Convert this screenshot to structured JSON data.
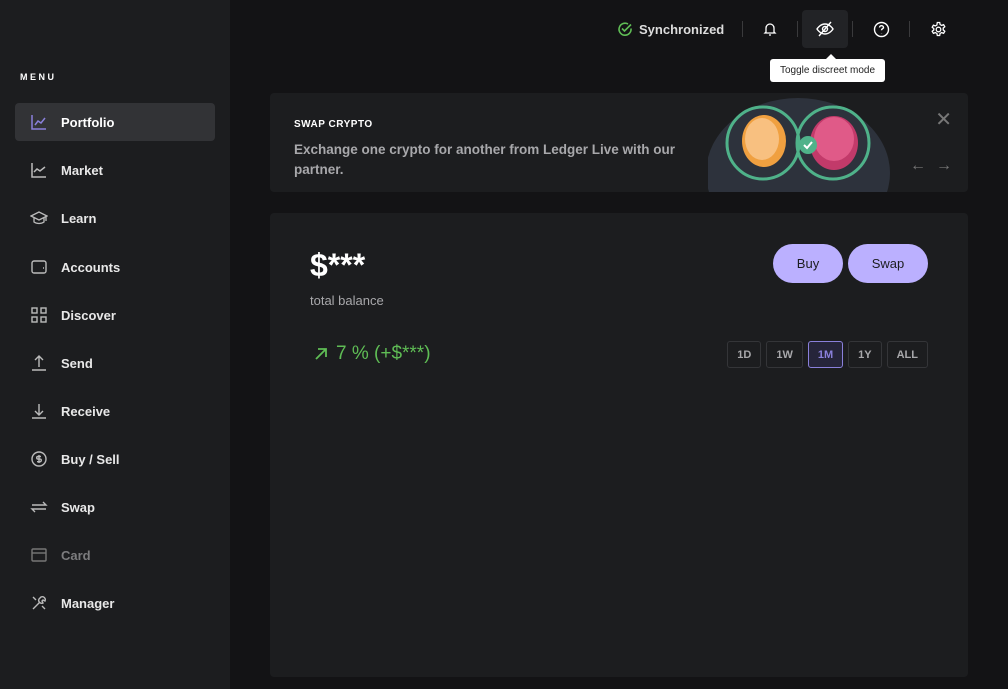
{
  "sidebar": {
    "title": "MENU",
    "items": [
      {
        "label": "Portfolio",
        "icon": "chart-line-icon",
        "active": true
      },
      {
        "label": "Market",
        "icon": "market-icon"
      },
      {
        "label": "Learn",
        "icon": "graduation-cap-icon"
      },
      {
        "label": "Accounts",
        "icon": "wallet-icon"
      },
      {
        "label": "Discover",
        "icon": "grid-icon"
      },
      {
        "label": "Send",
        "icon": "arrow-up-icon"
      },
      {
        "label": "Receive",
        "icon": "arrow-down-icon"
      },
      {
        "label": "Buy / Sell",
        "icon": "dollar-circle-icon"
      },
      {
        "label": "Swap",
        "icon": "swap-icon"
      },
      {
        "label": "Card",
        "icon": "card-icon",
        "disabled": true
      },
      {
        "label": "Manager",
        "icon": "tools-icon"
      }
    ]
  },
  "topbar": {
    "status": "Synchronized",
    "tooltip": "Toggle discreet mode"
  },
  "banner": {
    "title": "SWAP CRYPTO",
    "text": "Exchange one crypto for another from Ledger Live with our partner."
  },
  "portfolio": {
    "balance": "$***",
    "balance_label": "total balance",
    "delta": "7 % (+$***)",
    "buy": "Buy",
    "swap": "Swap",
    "ranges": [
      "1D",
      "1W",
      "1M",
      "1Y",
      "ALL"
    ],
    "selected_range": "1M"
  },
  "colors": {
    "accent": "#bbb0ff",
    "positive": "#5fbd55"
  }
}
